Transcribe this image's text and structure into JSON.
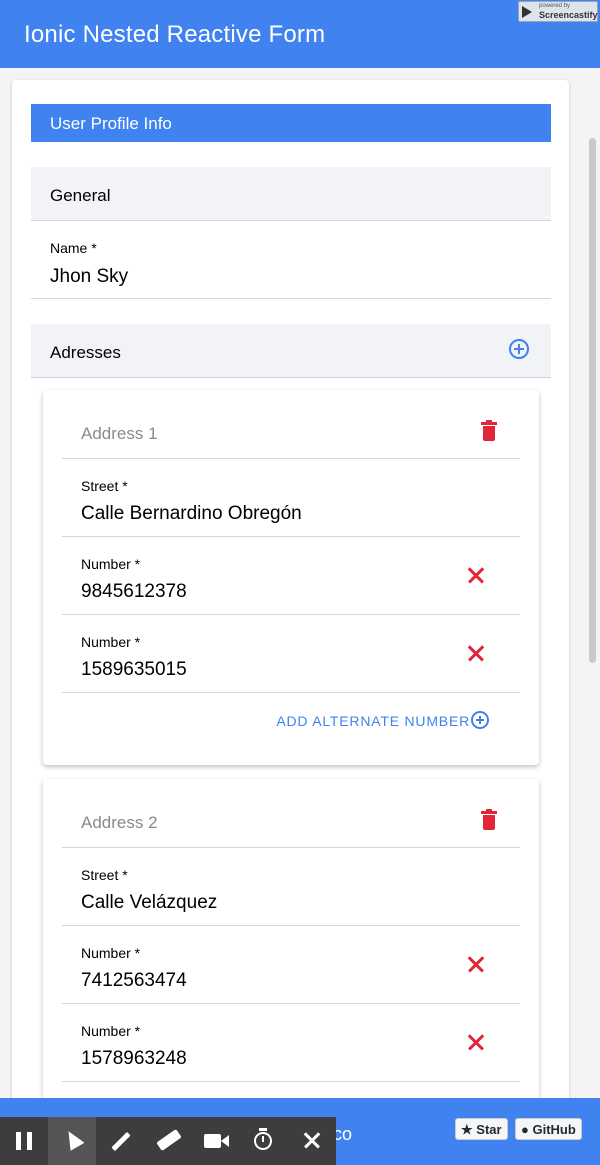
{
  "app": {
    "title": "Ionic Nested Reactive Form"
  },
  "badge": {
    "line1": "powered by",
    "line2": "Screencastify"
  },
  "form": {
    "section_title": "User Profile Info",
    "general_header": "General",
    "name": {
      "label": "Name *",
      "value": "Jhon Sky"
    },
    "addresses_header": "Adresses",
    "addresses": [
      {
        "title": "Address 1",
        "street": {
          "label": "Street *",
          "value": "Calle Bernardino Obregón"
        },
        "numbers": [
          {
            "label": "Number *",
            "value": "9845612378"
          },
          {
            "label": "Number *",
            "value": "1589635015"
          }
        ],
        "add_alternate_label": "ADD ALTERNATE NUMBER"
      },
      {
        "title": "Address 2",
        "street": {
          "label": "Street *",
          "value": "Calle Velázquez"
        },
        "numbers": [
          {
            "label": "Number *",
            "value": "7412563474"
          },
          {
            "label": "Number *",
            "value": "1578963248"
          }
        ]
      }
    ]
  },
  "footer": {
    "partial_text": "co",
    "star_label": "Star",
    "github_label": "GitHub"
  },
  "recorder_tools": [
    "pause-icon",
    "cursor-icon",
    "pen-icon",
    "eraser-icon",
    "camera-icon",
    "timer-icon",
    "close-icon"
  ],
  "colors": {
    "primary": "#3f82f0",
    "danger": "#e0273a"
  }
}
